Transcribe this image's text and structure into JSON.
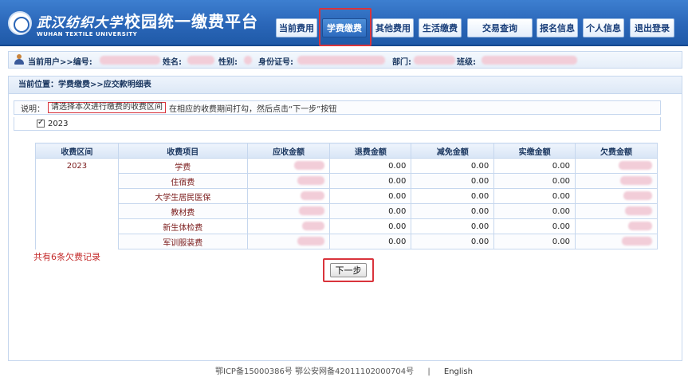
{
  "header": {
    "university_cn": "武汉纺织大学",
    "platform_title": "校园统一缴费平台",
    "university_en": "WUHAN TEXTILE UNIVERSITY",
    "brand_color": "#2a66b8"
  },
  "nav": [
    {
      "label": "当前费用",
      "active": false
    },
    {
      "label": "学费缴费",
      "active": true
    },
    {
      "label": "其他费用",
      "active": false
    },
    {
      "label": "生活缴费",
      "active": false
    },
    {
      "label": "交易查询",
      "active": false
    },
    {
      "label": "报名信息",
      "active": false
    },
    {
      "label": "个人信息",
      "active": false
    },
    {
      "label": "退出登录",
      "active": false
    }
  ],
  "userbar": {
    "current_user": "当前用户>>编号:",
    "name": "姓名:",
    "gender": "性别:",
    "id_card": "身份证号:",
    "department": "部门:",
    "class": "班级:"
  },
  "breadcrumb": "当前位置：学费缴费>>应交款明细表",
  "notice": {
    "prefix": "说明：",
    "highlight": "请选择本次进行缴费的收费区间",
    "rest": "在相应的收费期间打勾，然后点击“下一步”按钮"
  },
  "period_checkbox": {
    "label": "2023",
    "checked": true
  },
  "table": {
    "headers": [
      "收费区间",
      "收费项目",
      "应收金额",
      "退费金额",
      "减免金额",
      "实缴金额",
      "欠费金额"
    ],
    "period": "2023",
    "rows": [
      {
        "item": "学费",
        "refund": "0.00",
        "reduction": "0.00",
        "paid": "0.00"
      },
      {
        "item": "住宿费",
        "refund": "0.00",
        "reduction": "0.00",
        "paid": "0.00"
      },
      {
        "item": "大学生居民医保",
        "refund": "0.00",
        "reduction": "0.00",
        "paid": "0.00"
      },
      {
        "item": "教材费",
        "refund": "0.00",
        "reduction": "0.00",
        "paid": "0.00"
      },
      {
        "item": "新生体检费",
        "refund": "0.00",
        "reduction": "0.00",
        "paid": "0.00"
      },
      {
        "item": "军训服装费",
        "refund": "0.00",
        "reduction": "0.00",
        "paid": "0.00"
      }
    ]
  },
  "summary": "共有6条欠费记录",
  "next_button": "下一步",
  "footer": {
    "icp": "鄂ICP备15000386号 鄂公安网备42011102000704号",
    "separator": "|",
    "language": "English"
  }
}
